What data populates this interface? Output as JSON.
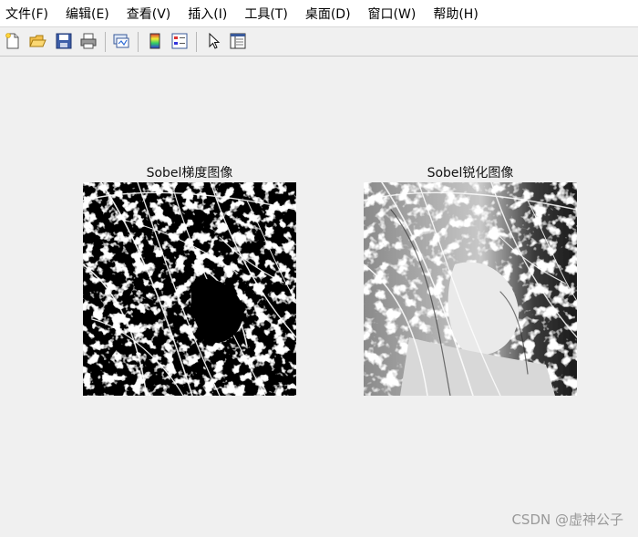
{
  "menubar": {
    "items": [
      "文件(F)",
      "编辑(E)",
      "查看(V)",
      "插入(I)",
      "工具(T)",
      "桌面(D)",
      "窗口(W)",
      "帮助(H)"
    ]
  },
  "toolbar": {
    "icons": [
      "new-figure-icon",
      "open-icon",
      "save-icon",
      "print-icon",
      "link-plot-icon",
      "colorbar-icon",
      "legend-icon",
      "select-arrow-icon",
      "property-inspector-icon"
    ]
  },
  "figure": {
    "left_axes_title": "Sobel梯度图像",
    "right_axes_title": "Sobel锐化图像"
  },
  "watermark": "CSDN @虚神公子",
  "colors": {
    "background": "#f0f0f0",
    "menubar": "#ffffff"
  }
}
